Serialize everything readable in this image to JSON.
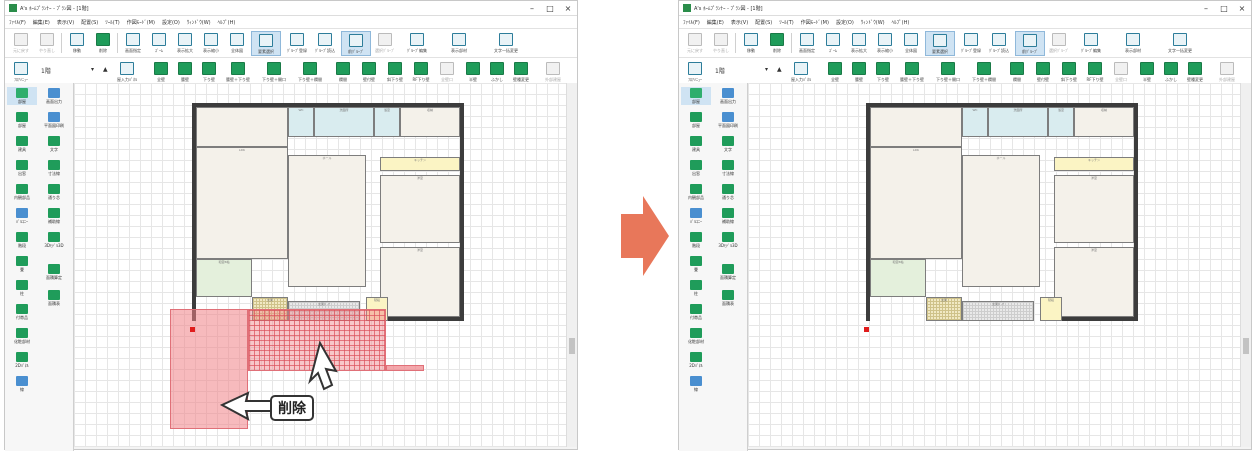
{
  "window": {
    "title": "A's ﾎｰﾑﾌﾟﾗﾝﾅｰ - ﾌﾟﾗﾝ図 - [1階]",
    "minimize": "–",
    "maximize": "□",
    "close": "×"
  },
  "menu": [
    "ﾌｧｲﾙ(F)",
    "編集(E)",
    "表示(V)",
    "配置(S)",
    "ﾂｰﾙ(T)",
    "作図ﾓｰﾄﾞ(M)",
    "設定(O)",
    "ｳｨﾝﾄﾞｳ(W)",
    "ﾍﾙﾌﾟ(H)"
  ],
  "ribbon1": [
    "元に戻す",
    "やり直し",
    "移動",
    "削除",
    "画面指定",
    "ｽﾞｰﾑ",
    "表示拡大",
    "表示縮小",
    "全体図",
    "要素選択",
    "ｸﾞﾙｰﾌﾟ登録",
    "ｸﾞﾙｰﾌﾟ読込",
    "前ｸﾞﾙｰﾌﾟ",
    "選択ｸﾞﾙｰﾌﾟ",
    "ｸﾞﾙｰﾌﾟ編集",
    "表示部材",
    "文字一括変更"
  ],
  "ribbon2": {
    "floor_menu": "ﾌﾛｱﾒﾆｭｰ",
    "floor": "1階",
    "items": [
      "屋入力ﾊﾟﾈﾙ",
      "全壁",
      "腰壁",
      "下り壁",
      "腰壁＋下り壁",
      "下り壁＋開口",
      "下り壁＋欄間",
      "欄間",
      "壁付壁",
      "斜下り壁",
      "RF下り壁",
      "全壁口",
      "半壁",
      "ふかし",
      "壁種変更",
      "外部建屋"
    ]
  },
  "side_left": [
    "部屋",
    "部屋",
    "建具",
    "出窓",
    "内観部品",
    "ﾊﾞﾙｺﾆｰ",
    "階段",
    "畳",
    "柱",
    "付帯品",
    "化粧部材",
    "2Dﾊﾟﾈﾙ",
    "線"
  ],
  "side_right": [
    "画面出力",
    "平面図印刷",
    "文字",
    "寸法線",
    "通り芯",
    "補助線",
    "3Dﾓﾃﾞﾙ3D",
    "面積算定",
    "面積表"
  ],
  "rooms": {
    "wc": "WC",
    "wash": "洗面所",
    "bath": "浴室",
    "kitchen": "キッチン",
    "ldk": "LDK",
    "japanese": "和室",
    "storage": "収納",
    "entrance": "玄関",
    "stairs": "階段",
    "hall": "ホール",
    "porch": "玄関ﾎﾟｰﾁ",
    "wood_deck": "ｳｯﾄﾞﾃﾞｯｷ",
    "room_a": "洋室",
    "room_b": "洋室",
    "tatami_label": "和室6帖"
  },
  "callout": {
    "label": "削除"
  },
  "colors": {
    "accent": "#e8775a",
    "pink": "#f08287",
    "red": "#e01c1c",
    "green_icon": "#1f9c5a"
  }
}
